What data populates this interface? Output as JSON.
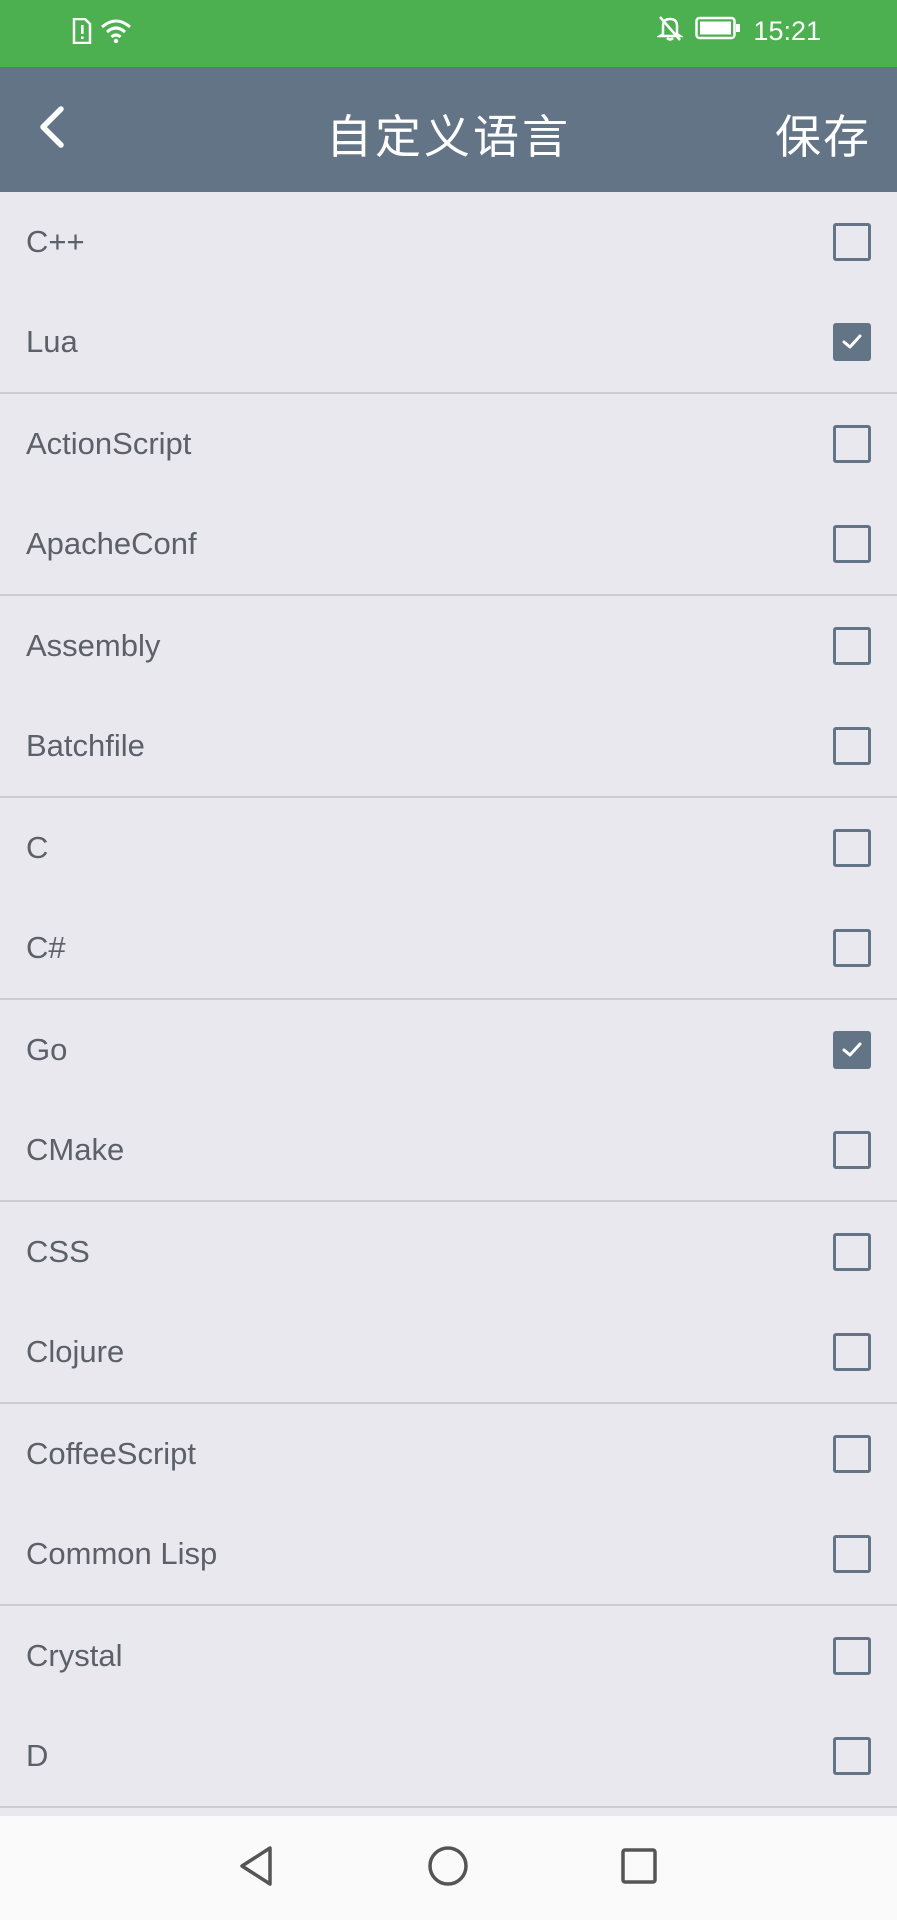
{
  "status_bar": {
    "time": "15:21",
    "icons": [
      "sim-alert-icon",
      "wifi-icon",
      "bell-off-icon",
      "battery-icon"
    ],
    "background": "#4CAF50"
  },
  "app_bar": {
    "title": "自定义语言",
    "save_label": "保存",
    "background": "#637487"
  },
  "languages": [
    {
      "label": "C++",
      "checked": false
    },
    {
      "label": "Lua",
      "checked": true
    },
    {
      "label": "ActionScript",
      "checked": false
    },
    {
      "label": "ApacheConf",
      "checked": false
    },
    {
      "label": "Assembly",
      "checked": false
    },
    {
      "label": "Batchfile",
      "checked": false
    },
    {
      "label": "C",
      "checked": false
    },
    {
      "label": "C#",
      "checked": false
    },
    {
      "label": "Go",
      "checked": true
    },
    {
      "label": "CMake",
      "checked": false
    },
    {
      "label": "CSS",
      "checked": false
    },
    {
      "label": "Clojure",
      "checked": false
    },
    {
      "label": "CoffeeScript",
      "checked": false
    },
    {
      "label": "Common Lisp",
      "checked": false
    },
    {
      "label": "Crystal",
      "checked": false
    },
    {
      "label": "D",
      "checked": false
    }
  ],
  "nav_bar": {
    "icons": [
      "back-triangle-icon",
      "home-circle-icon",
      "recents-square-icon"
    ]
  }
}
